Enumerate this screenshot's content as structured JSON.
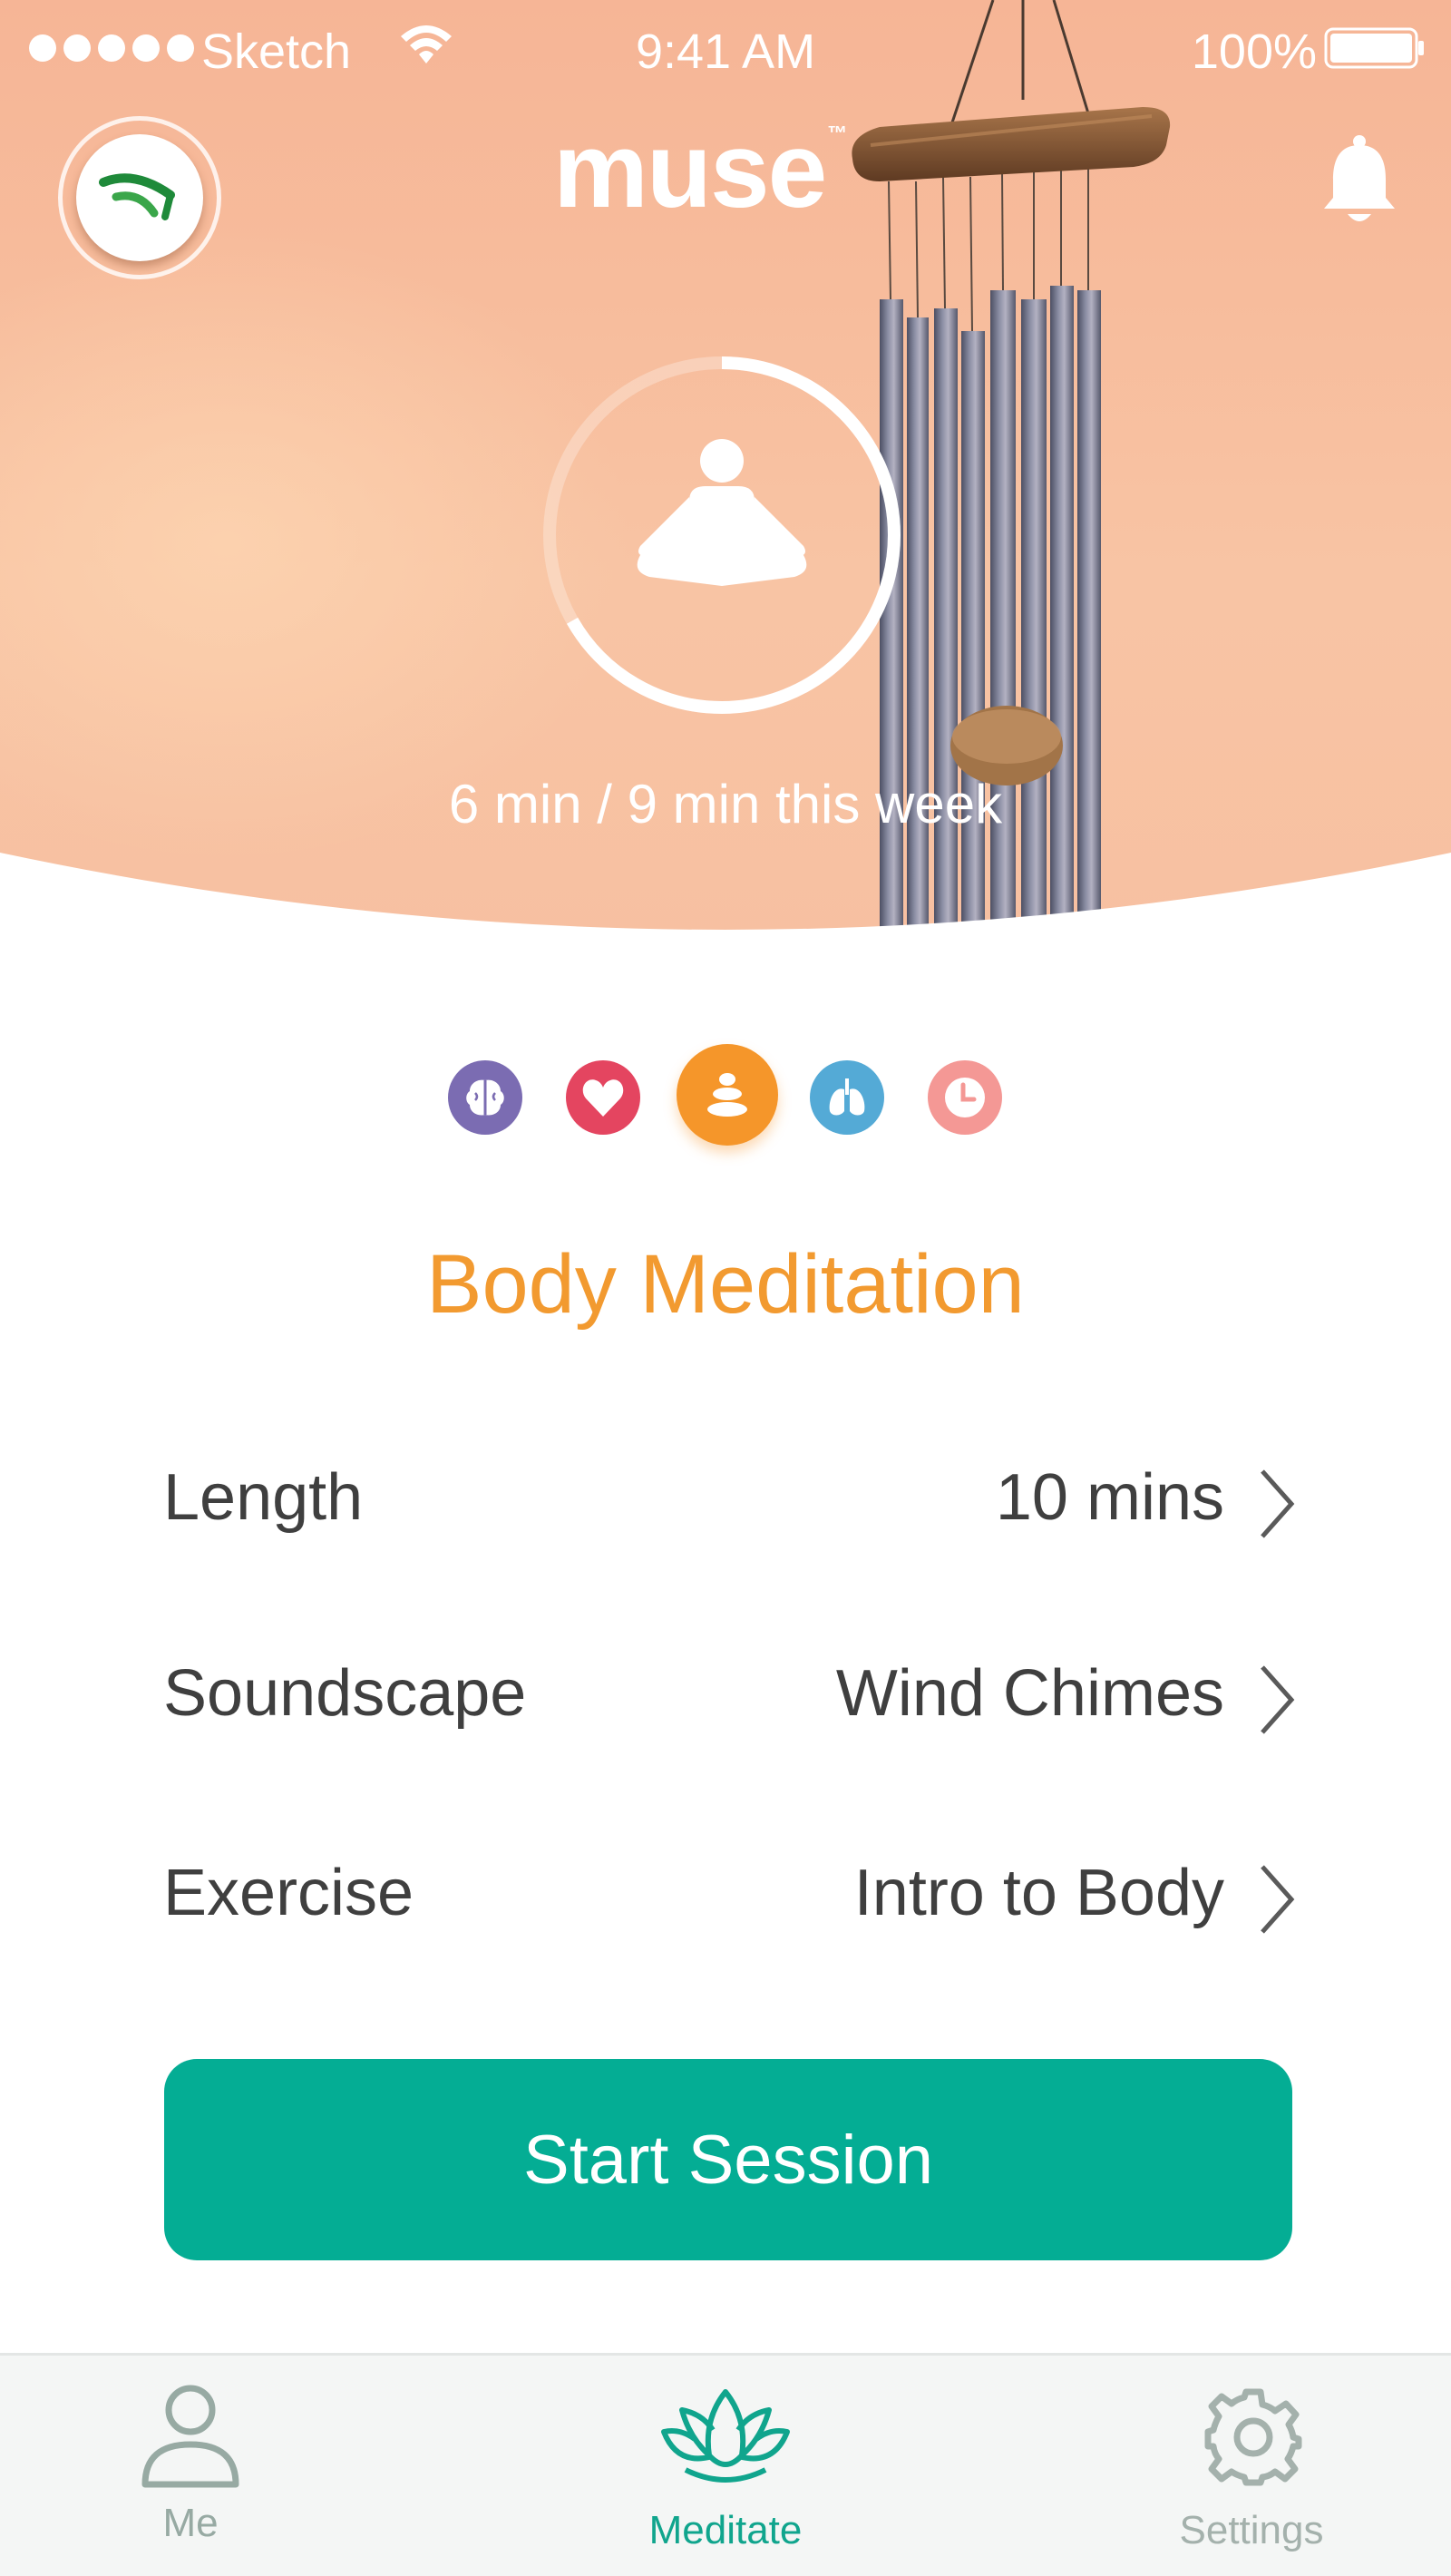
{
  "status_bar": {
    "carrier": "Sketch",
    "time": "9:41 AM",
    "battery": "100%"
  },
  "header": {
    "logo": "muse",
    "trademark": "™"
  },
  "progress": {
    "summary": "6 min / 9 min this week",
    "fraction": 0.667
  },
  "categories": [
    {
      "icon": "brain-icon",
      "color": "#7b6cb2",
      "selected": false
    },
    {
      "icon": "heart-icon",
      "color": "#e44560",
      "selected": false
    },
    {
      "icon": "stones-icon",
      "color": "#f5962a",
      "selected": true
    },
    {
      "icon": "lungs-icon",
      "color": "#54aad6",
      "selected": false
    },
    {
      "icon": "clock-icon",
      "color": "#f49895",
      "selected": false
    }
  ],
  "session": {
    "title": "Body Meditation",
    "options": [
      {
        "label": "Length",
        "value": "10 mins"
      },
      {
        "label": "Soundscape",
        "value": "Wind Chimes"
      },
      {
        "label": "Exercise",
        "value": "Intro to Body"
      }
    ],
    "start_label": "Start Session"
  },
  "tabs": [
    {
      "label": "Me",
      "icon": "person-icon",
      "active": false
    },
    {
      "label": "Meditate",
      "icon": "lotus-icon",
      "active": true
    },
    {
      "label": "Settings",
      "icon": "gear-icon",
      "active": false
    }
  ],
  "colors": {
    "accent": "#04ad94",
    "title": "#f29a30",
    "hero": "#f7bc9c"
  }
}
